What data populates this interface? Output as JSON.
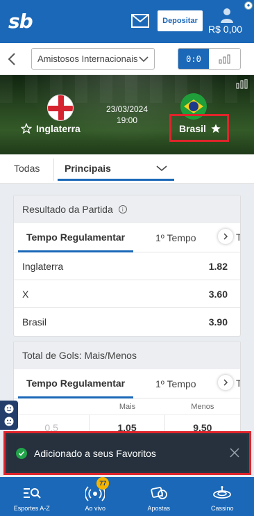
{
  "header": {
    "logo": "sb",
    "deposit_label": "Depositar",
    "balance": "R$ 0,00",
    "icons": [
      "mail-icon",
      "user-icon"
    ]
  },
  "competition": {
    "selected": "Amistosos Internacionais",
    "score_toggle_label": "0:0"
  },
  "match": {
    "date": "23/03/2024",
    "time": "19:00",
    "home": "Inglaterra",
    "away": "Brasil",
    "home_favorite": false,
    "away_favorite": true
  },
  "market_tabs": {
    "all": "Todas",
    "selected": "Principais"
  },
  "result_market": {
    "title": "Resultado da Partida",
    "tabs": [
      "Tempo Regulamentar",
      "1º Tempo",
      "T"
    ],
    "rows": [
      {
        "label": "Inglaterra",
        "odds": "1.82"
      },
      {
        "label": "X",
        "odds": "3.60"
      },
      {
        "label": "Brasil",
        "odds": "3.90"
      }
    ]
  },
  "goals_market": {
    "title": "Total de Gols: Mais/Menos",
    "tabs": [
      "Tempo Regulamentar",
      "1º Tempo",
      "T"
    ],
    "columns": [
      "Mais",
      "Menos"
    ],
    "rows": [
      {
        "line": "0.5",
        "over": "1.05",
        "under": "9.50"
      }
    ]
  },
  "toast": {
    "message": "Adicionado a seus Favoritos"
  },
  "bottom_nav": {
    "items": [
      {
        "label": "Esportes A-Z",
        "icon": "search-list-icon"
      },
      {
        "label": "Ao vivo",
        "icon": "live-icon",
        "badge": "77"
      },
      {
        "label": "Apostas",
        "icon": "bets-icon"
      },
      {
        "label": "Cassino",
        "icon": "casino-icon"
      }
    ]
  },
  "colors": {
    "brand": "#1b68b8",
    "highlight": "#e0242b",
    "toast_bg": "#26313d",
    "success": "#22a34a"
  }
}
